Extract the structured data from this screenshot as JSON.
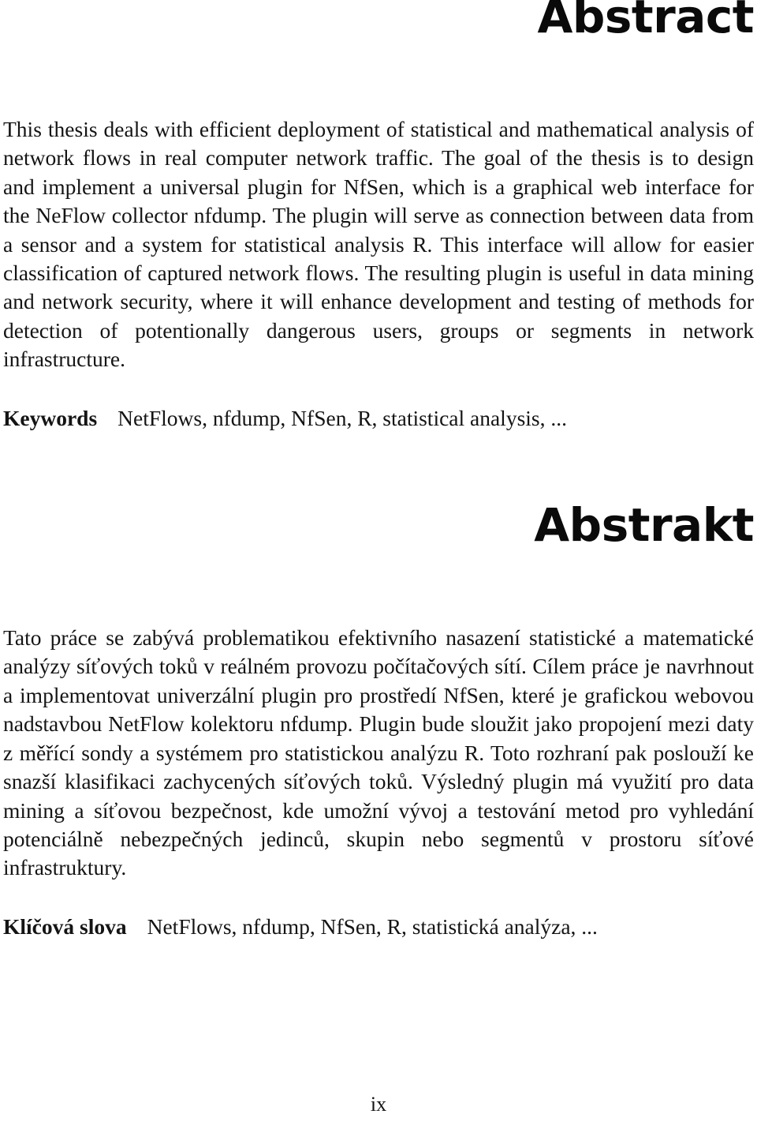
{
  "page": {
    "number": "ix"
  },
  "sections": {
    "english": {
      "heading": "Abstract",
      "paragraph": "This thesis deals with efficient deployment of statistical and mathematical analysis of network flows in real computer network traffic. The goal of the thesis is to design and implement a universal plugin for NfSen, which is a graphical web interface for the NeFlow collector nfdump. The plugin will serve as connection between data from a sensor and a system for statistical analysis R. This interface will allow for easier classification of captured network flows. The resulting plugin is useful in data mining and network security, where it will enhance development and testing of methods for detection of potentionally dangerous users, groups or segments in network infrastructure.",
      "keywords_label": "Keywords",
      "keywords_value": "NetFlows, nfdump, NfSen, R, statistical analysis, ..."
    },
    "czech": {
      "heading": "Abstrakt",
      "paragraph": "Tato práce se zabývá problematikou efektivního nasazení statistické a matematické analýzy síťových toků v reálném provozu počítačových sítí. Cílem práce je navrhnout a implementovat univerzální plugin pro prostředí NfSen, které je grafickou webovou nadstavbou NetFlow kolektoru nfdump. Plugin bude sloužit jako propojení mezi daty z měřící sondy a systémem pro statistickou analýzu R. Toto rozhraní pak poslouží ke snazší klasifikaci zachycených síťových toků. Výsledný plugin má využití pro data mining a síťovou bezpečnost, kde umožní vývoj a testování metod pro vyhledání potenciálně nebezpečných jedinců, skupin nebo segmentů v prostoru síťové infrastruktury.",
      "keywords_label": "Klíčová slova",
      "keywords_value": "NetFlows, nfdump, NfSen, R, statistická analýza, ..."
    }
  }
}
